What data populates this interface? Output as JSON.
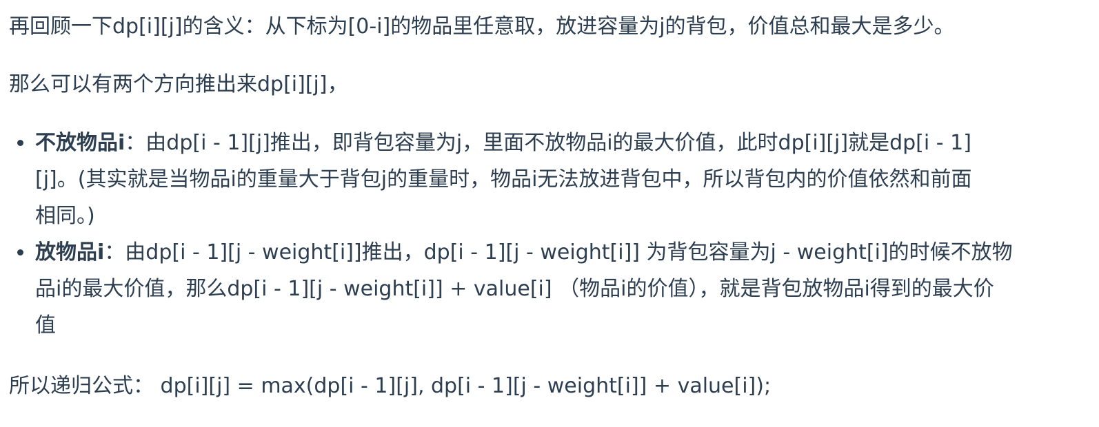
{
  "paragraphs": {
    "recap": "再回顾一下dp[i][j]的含义：从下标为[0-i]的物品里任意取，放进容量为j的背包，价值总和最大是多少。",
    "two_directions": "那么可以有两个方向推出来dp[i][j]，",
    "formula": "所以递归公式： dp[i][j] = max(dp[i - 1][j], dp[i - 1][j - weight[i]] + value[i]);"
  },
  "bullets": [
    {
      "term": "不放物品i",
      "lines": [
        "：由dp[i - 1][j]推出，即背包容量为j，里面不放物品i的最大价值，此时dp[i][j]就是dp[i - 1]",
        "[j]。(其实就是当物品i的重量大于背包j的重量时，物品i无法放进背包中，所以背包内的价值依然和前面",
        "相同。)"
      ]
    },
    {
      "term": "放物品i",
      "lines": [
        "：由dp[i - 1][j - weight[i]]推出，dp[i - 1][j - weight[i]] 为背包容量为j - weight[i]的时候不放物",
        "品i的最大价值，那么dp[i - 1][j - weight[i]] + value[i] （物品i的价值），就是背包放物品i得到的最大价",
        "值"
      ]
    }
  ]
}
